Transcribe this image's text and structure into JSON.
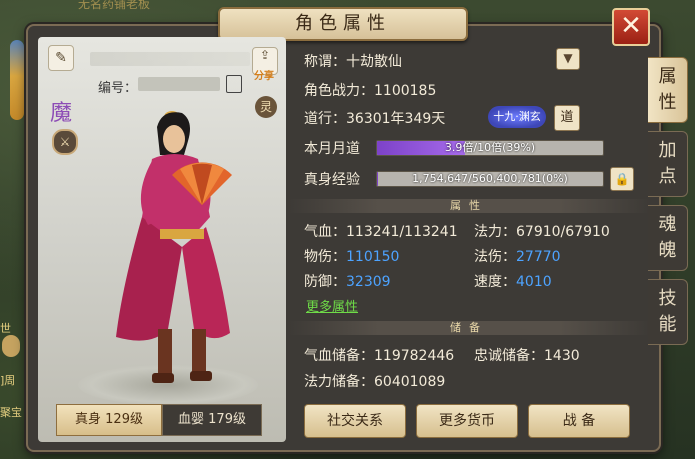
{
  "window": {
    "title": "角色属性",
    "close_icon": "close-icon",
    "accent_color": "#d24a35"
  },
  "background": {
    "npc_title": "无名药铺老板",
    "chat_lines": [
      "世",
      "]周",
      "聚宝"
    ]
  },
  "character": {
    "id_label": "编号：",
    "share_label": "分享",
    "ling_label": "灵",
    "faction_label": "魔",
    "realm_tabs": [
      {
        "label": "真身 129级",
        "active": true
      },
      {
        "label": "血婴 179级",
        "active": false
      }
    ]
  },
  "attributes": {
    "title_label": "称谓：",
    "title_value": "十劫散仙",
    "power_label": "角色战力：",
    "power_value": "1100185",
    "dao_label": "道行：",
    "dao_value": "36301年349天",
    "dao_badge": "十九·渊玄",
    "dao_button": "道",
    "monthly_dao_label": "本月月道",
    "monthly_dao_text": "3.9倍/10倍(39%)",
    "monthly_dao_fraction": 0.39,
    "true_body_exp_label": "真身经验",
    "true_body_exp_text": "1,754,647/560,400,781(0%)",
    "true_body_exp_fraction": 0.003,
    "section_attrs": "属性",
    "hp_label": "气血：",
    "hp_value": "113241/113241",
    "mp_label": "法力：",
    "mp_value": "67910/67910",
    "phys_dmg_label": "物伤：",
    "phys_dmg_value": "110150",
    "mag_dmg_label": "法伤：",
    "mag_dmg_value": "27770",
    "defense_label": "防御：",
    "defense_value": "32309",
    "speed_label": "速度：",
    "speed_value": "4010",
    "more_attrs": "更多属性",
    "section_reserve": "储备",
    "hp_reserve_label": "气血储备：",
    "hp_reserve_value": "119782446",
    "loyalty_reserve_label": "忠诚储备：",
    "loyalty_reserve_value": "1430",
    "mp_reserve_label": "法力储备：",
    "mp_reserve_value": "60401089"
  },
  "footer_buttons": [
    "社交关系",
    "更多货币",
    "战 备"
  ],
  "side_tabs": [
    {
      "label": "属\n性",
      "active": true
    },
    {
      "label": "加\n点",
      "active": false
    },
    {
      "label": "魂\n魄",
      "active": false
    },
    {
      "label": "技\n能",
      "active": false
    }
  ]
}
